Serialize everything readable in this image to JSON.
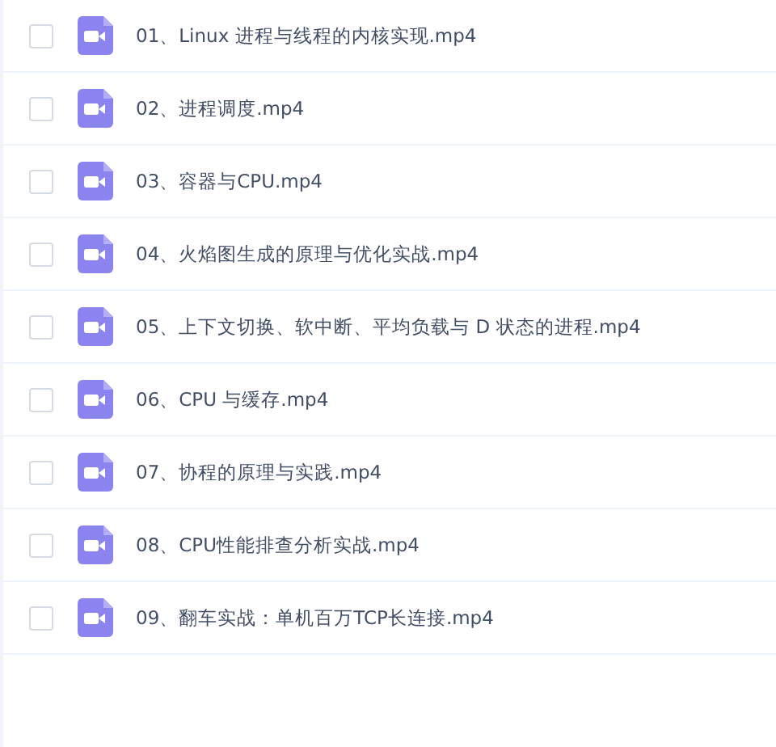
{
  "files": [
    {
      "name": "01、Linux 进程与线程的内核实现.mp4",
      "checked": false
    },
    {
      "name": "02、进程调度.mp4",
      "checked": false
    },
    {
      "name": "03、容器与CPU.mp4",
      "checked": false
    },
    {
      "name": "04、火焰图生成的原理与优化实战.mp4",
      "checked": false
    },
    {
      "name": "05、上下文切换、软中断、平均负载与 D 状态的进程.mp4",
      "checked": false
    },
    {
      "name": "06、CPU 与缓存.mp4",
      "checked": false
    },
    {
      "name": "07、协程的原理与实践.mp4",
      "checked": false
    },
    {
      "name": "08、CPU性能排查分析实战.mp4",
      "checked": false
    },
    {
      "name": "09、翻车实战：单机百万TCP长连接.mp4",
      "checked": false
    }
  ]
}
